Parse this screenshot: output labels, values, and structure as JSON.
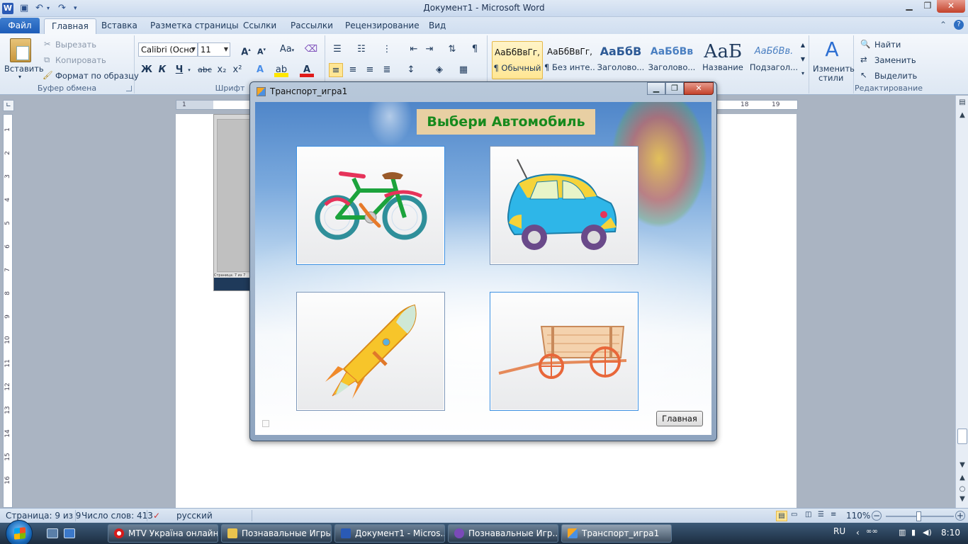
{
  "word": {
    "title": "Документ1  -  Microsoft Word",
    "logo_letter": "W",
    "tabs": [
      {
        "label": "Файл"
      },
      {
        "label": "Главная"
      },
      {
        "label": "Вставка"
      },
      {
        "label": "Разметка страницы"
      },
      {
        "label": "Ссылки"
      },
      {
        "label": "Рассылки"
      },
      {
        "label": "Рецензирование"
      },
      {
        "label": "Вид"
      }
    ],
    "clipboard": {
      "paste": "Вставить",
      "cut": "Вырезать",
      "copy": "Копировать",
      "format_painter": "Формат по образцу",
      "group": "Буфер обмена"
    },
    "font": {
      "name": "Calibri (Осно",
      "size": "11",
      "group": "Шрифт",
      "bold": "Ж",
      "italic": "К",
      "underline": "Ч",
      "strike": "abc",
      "sub": "x₂",
      "sup": "x²",
      "case": "Aa"
    },
    "styles": [
      {
        "preview": "АаБбВвГг,",
        "name": "¶ Обычный",
        "selected": true
      },
      {
        "preview": "АаБбВвГг,",
        "name": "¶ Без инте..."
      },
      {
        "preview": "АаБбВ",
        "name": "Заголово..."
      },
      {
        "preview": "АаБбВв",
        "name": "Заголово..."
      },
      {
        "preview": "АаБ",
        "name": "Название"
      },
      {
        "preview": "АаБбВв.",
        "name": "Подзагол..."
      }
    ],
    "change_styles": {
      "line1": "Изменить",
      "line2": "стили"
    },
    "editing": {
      "find": "Найти",
      "replace": "Заменить",
      "select": "Выделить",
      "group": "Редактирование"
    },
    "ruler_h": [
      "1",
      "18",
      "19"
    ],
    "ruler_v": [
      "1",
      "2",
      "3",
      "4",
      "5",
      "6",
      "7",
      "8",
      "9",
      "10",
      "11",
      "12",
      "13",
      "14",
      "15",
      "16"
    ],
    "thumb_status": "Страница: 7 из 7",
    "status": {
      "page": "Страница: 9 из 9",
      "words": "Число слов: 413",
      "lang": "русский",
      "zoom": "110%"
    }
  },
  "dialog": {
    "title": "Транспорт_игра1",
    "heading": "Выбери Автомобиль",
    "button": "Главная",
    "cards": [
      {
        "icon": "bicycle-icon"
      },
      {
        "icon": "car-icon"
      },
      {
        "icon": "rocket-icon"
      },
      {
        "icon": "cart-icon"
      }
    ]
  },
  "taskbar": {
    "items": [
      {
        "label": "MTV Україна онлайн..."
      },
      {
        "label": "Познавальные Игры"
      },
      {
        "label": "Документ1 - Micros..."
      },
      {
        "label": "Познавальные Игр..."
      },
      {
        "label": "Транспорт_игра1"
      }
    ],
    "lang": "RU",
    "time": "8:10"
  },
  "colors": {
    "heading_text": "#178a1d",
    "heading_bg": "#e8cfa3",
    "file_tab": "#1d5cb8",
    "selected_style": "#ffe694"
  }
}
